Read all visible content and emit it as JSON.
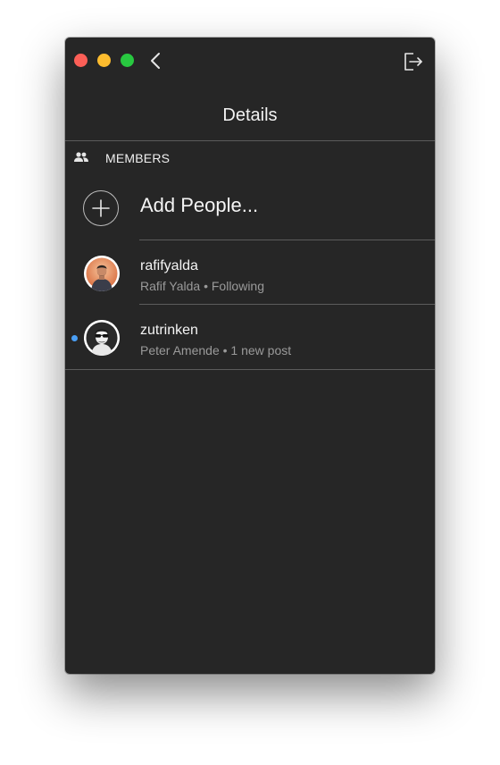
{
  "window": {
    "title": "Details",
    "background": "#262626",
    "controls": [
      "close",
      "minimize",
      "zoom"
    ],
    "icons": {
      "back": "chevron-left-icon",
      "leave": "leave-conversation-icon"
    }
  },
  "section": {
    "icon": "members-icon",
    "label": "MEMBERS"
  },
  "add_people": {
    "icon": "plus-circle-icon",
    "label": "Add People..."
  },
  "members": [
    {
      "username": "rafifyalda",
      "full_name": "Rafif Yalda",
      "status": "Following",
      "subtitle": "Rafif Yalda • Following",
      "unread": false
    },
    {
      "username": "zutrinken",
      "full_name": "Peter Amende",
      "status": "1 new post",
      "subtitle": "Peter Amende • 1 new post",
      "unread": true,
      "unread_color": "#4a9ff5"
    }
  ]
}
